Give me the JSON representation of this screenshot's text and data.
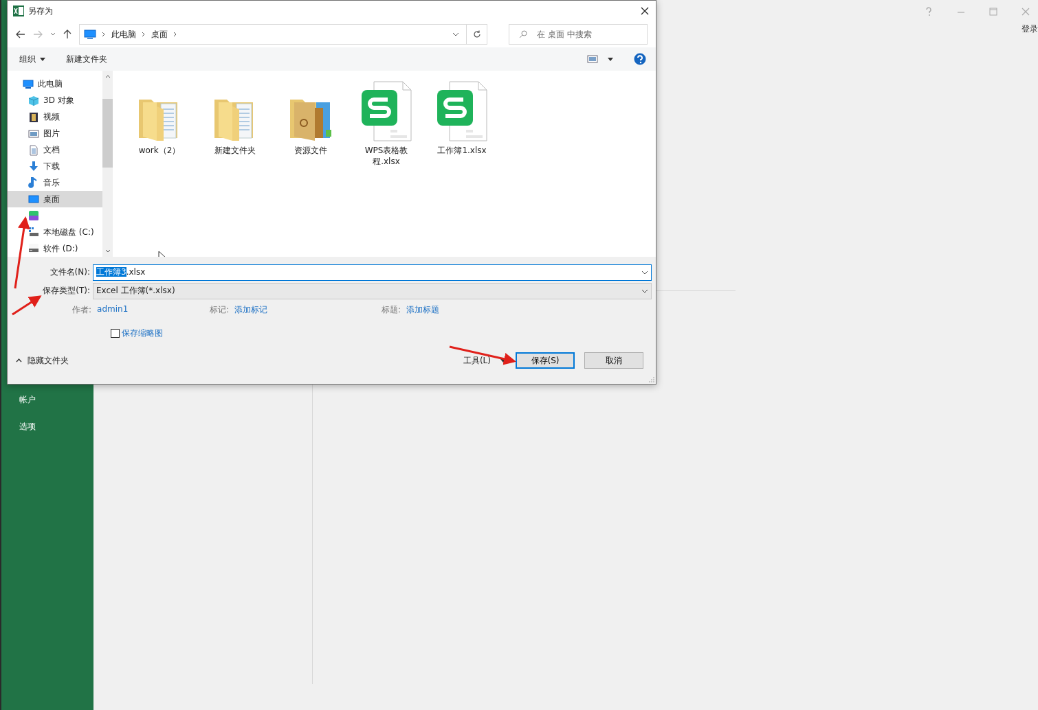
{
  "app": {
    "sidebar_items": [
      "帐户",
      "选项"
    ],
    "login": "登录"
  },
  "dialog": {
    "title": "另存为",
    "breadcrumb": [
      "此电脑",
      "桌面"
    ],
    "search": {
      "placeholder": "在 桌面 中搜索"
    },
    "toolbar": {
      "organize": "组织",
      "new_folder": "新建文件夹"
    },
    "nav_tree": [
      {
        "label": "此电脑",
        "kind": "computer",
        "selected": false,
        "children": [
          {
            "label": "3D 对象",
            "kind": "cube",
            "selected": false
          },
          {
            "label": "视频",
            "kind": "film",
            "selected": false
          },
          {
            "label": "图片",
            "kind": "picture",
            "selected": false
          },
          {
            "label": "文档",
            "kind": "document",
            "selected": false
          },
          {
            "label": "下载",
            "kind": "download",
            "selected": false
          },
          {
            "label": "音乐",
            "kind": "music",
            "selected": false
          },
          {
            "label": "桌面",
            "kind": "desktop",
            "selected": true
          },
          {
            "kind": "app",
            "selected": false
          },
          {
            "label": "本地磁盘 (C:)",
            "kind": "system-drive",
            "selected": false
          },
          {
            "label": "软件 (D:)",
            "kind": "drive",
            "selected": false
          }
        ]
      }
    ],
    "files": [
      {
        "name": "work（2）",
        "kind": "folder"
      },
      {
        "name": "新建文件夹",
        "kind": "folder"
      },
      {
        "name": "资源文件",
        "kind": "image-folder"
      },
      {
        "name": "WPS表格教程.xlsx",
        "kind": "sheet"
      },
      {
        "name": "工作簿1.xlsx",
        "kind": "sheet"
      }
    ],
    "filename": {
      "label": "文件名(N):",
      "value_parts": [
        {
          "text": "工作簿3",
          "selected": true
        },
        {
          "text": ".xlsx",
          "selected": false
        }
      ]
    },
    "save_type": {
      "label": "保存类型(T):",
      "value": "Excel 工作簿(*.xlsx)"
    },
    "meta": [
      {
        "label": "作者:",
        "value": "admin1"
      },
      {
        "label": "标记:",
        "value": "添加标记"
      },
      {
        "label": "标题:",
        "value": "添加标题"
      }
    ],
    "thumbnail": {
      "label": "保存缩略图",
      "checked": false
    },
    "hide_folders": "隐藏文件夹",
    "tools": "工具(L)",
    "buttons": [
      {
        "label": "保存(S)",
        "default": true
      },
      {
        "label": "取消",
        "default": false
      }
    ]
  }
}
